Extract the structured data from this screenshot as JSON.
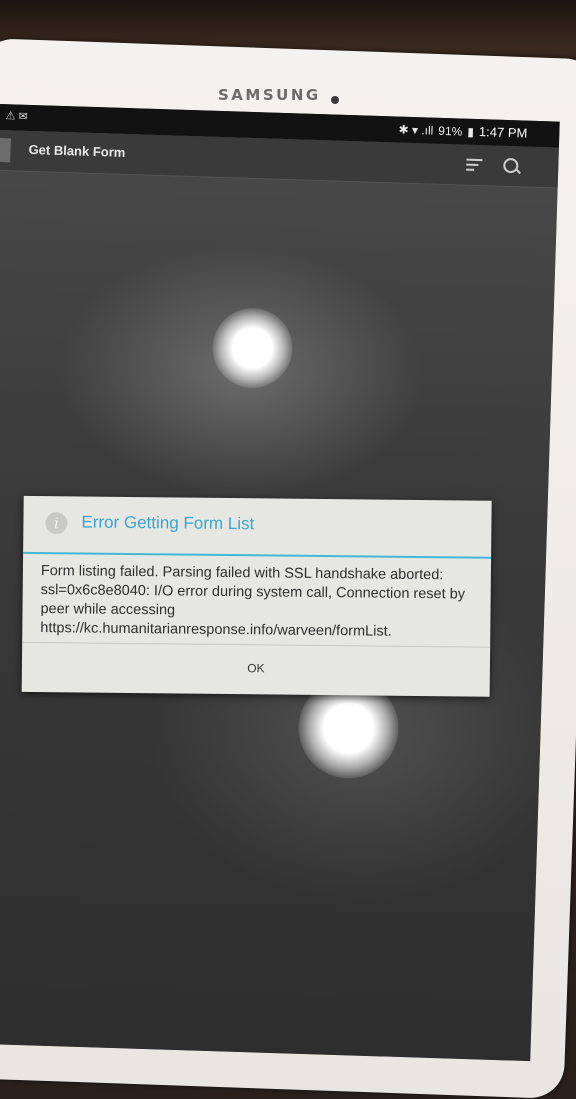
{
  "device": {
    "brand": "SAMSUNG"
  },
  "status_bar": {
    "left_icons": "⚠ ✉",
    "right_icons": "✱ ▾ .ıll",
    "battery": "91%",
    "time": "1:47 PM"
  },
  "action_bar": {
    "title": "Get Blank Form",
    "icons": [
      "sort-icon",
      "search-icon"
    ]
  },
  "dialog": {
    "title": "Error Getting Form List",
    "message": "Form listing failed. Parsing failed with SSL handshake aborted: ssl=0x6c8e8040: I/O error during system call, Connection reset by peer while accessing https://kc.humanitarianresponse.info/warveen/formList.",
    "ok_label": "OK",
    "accent": "#3aa6cf"
  }
}
